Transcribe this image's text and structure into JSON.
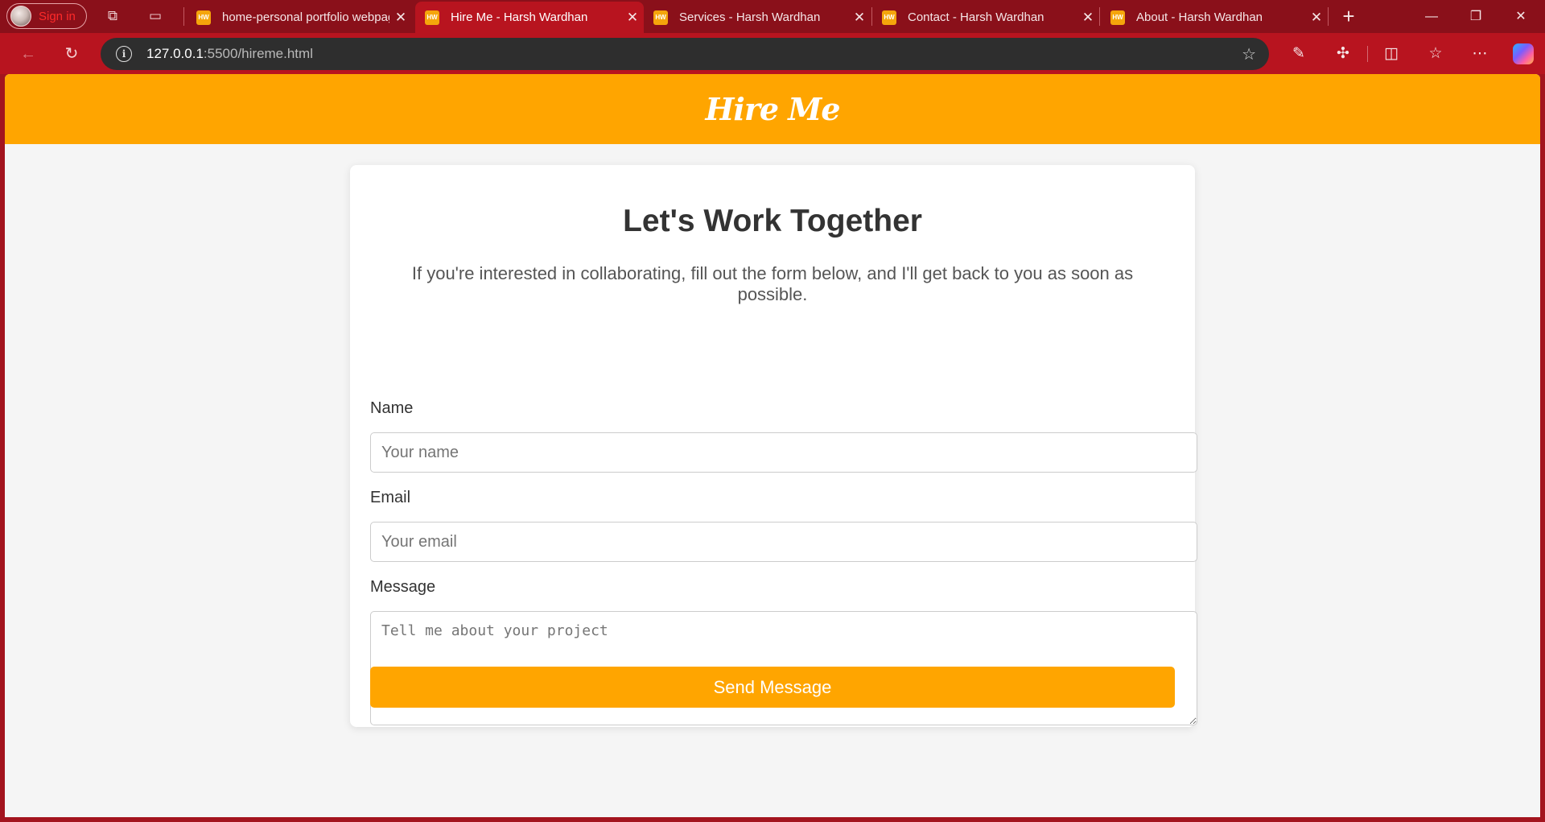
{
  "browser": {
    "profile_label": "Sign in",
    "tabs": [
      {
        "title": "home-personal portfolio webpage",
        "favicon": "HW",
        "active": false
      },
      {
        "title": "Hire Me - Harsh Wardhan",
        "favicon": "HW",
        "active": true
      },
      {
        "title": "Services - Harsh Wardhan",
        "favicon": "HW",
        "active": false
      },
      {
        "title": "Contact - Harsh Wardhan",
        "favicon": "HW",
        "active": false
      },
      {
        "title": "About - Harsh Wardhan",
        "favicon": "HW",
        "active": false
      }
    ],
    "url_host": "127.0.0.1",
    "url_rest": ":5500/hireme.html",
    "icons": {
      "workspaces": "workspaces-icon",
      "tab_actions": "tab-actions-icon",
      "new_tab": "plus-icon",
      "minimize": "minimize-icon",
      "restore": "restore-icon",
      "close": "close-icon",
      "back": "back-arrow-icon",
      "refresh": "refresh-icon",
      "site_info": "info-icon",
      "favorite": "star-icon",
      "eyedropper": "eyedropper-icon",
      "extensions": "puzzle-icon",
      "split_screen": "split-screen-icon",
      "favorites": "favorites-icon",
      "more": "more-icon",
      "copilot": "copilot-icon"
    }
  },
  "page": {
    "header_title": "Hire Me",
    "heading": "Let's Work Together",
    "intro": "If you're interested in collaborating, fill out the form below, and I'll get back to you as soon as possible.",
    "form": {
      "name_label": "Name",
      "name_placeholder": "Your name",
      "email_label": "Email",
      "email_placeholder": "Your email",
      "message_label": "Message",
      "message_placeholder": "Tell me about your project",
      "submit_label": "Send Message"
    }
  },
  "colors": {
    "brand_orange": "#ffa500",
    "browser_frame": "#b8141f",
    "page_background": "#f5f5f5"
  }
}
